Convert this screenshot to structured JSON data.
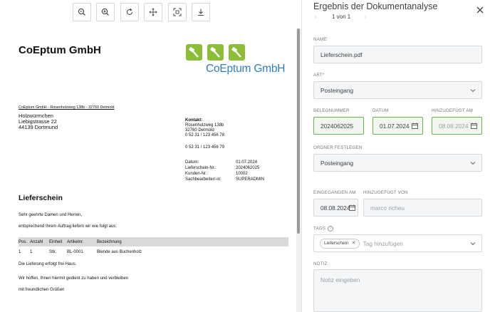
{
  "toolbar": {
    "buttons": [
      "zoom-out-icon",
      "zoom-in-icon",
      "rotate-icon",
      "move-icon",
      "fit-icon",
      "download-icon"
    ]
  },
  "document": {
    "company": "CoEptum GmbH",
    "logo_text": "CoEptum GmbH",
    "sender_line": "CoEptum GmbH - Rosenholzweg 138b - 32760 Detmold",
    "recipient": [
      "Holzwürmchen",
      "Liebigstrasse 22",
      "44139 Dortmund"
    ],
    "contact_title": "Kontakt:",
    "contact_lines": [
      "Rosenholzweg 138b",
      "32760 Detmold",
      "0 52 31 / 123 456 78"
    ],
    "contact_phone2": "0 52 31 / 123 456 79",
    "meta": [
      {
        "k": "Datum:",
        "v": "01.07.2024"
      },
      {
        "k": "Lieferschein-Nr.:",
        "v": "2024062025"
      },
      {
        "k": "Kunden-Nr.:",
        "v": "10002"
      },
      {
        "k": "Sachbearbeiter/-in:",
        "v": "SUPERADMIN"
      }
    ],
    "title": "Lieferschein",
    "greeting": "Sehr geehrte Damen und Herren,",
    "intro": "entsprechend Ihrem Auftrag liefern wir wie folgt aus:",
    "table_headers": [
      "Pos.",
      "Anzahl",
      "Einheit",
      "Artikelnr.",
      "Bezeichnung"
    ],
    "table_rows": [
      [
        "1",
        "1",
        "Stk.",
        "BL-0001",
        "Blende aus Buchenholz"
      ]
    ],
    "delivery_note": "Die Lieferung erfolgt frei Haus.",
    "closing": "Wir hoffen, Ihnen hiermit gedient zu haben und verbleiben",
    "regards": "mit freundlichen Grüßen"
  },
  "panel": {
    "title": "Ergebnis der Dokumentanalyse",
    "pager_prev": "‹",
    "pager_text": "1 von 1",
    "pager_next": "›",
    "name_label": "NAME",
    "name_value": "Lieferschein.pdf",
    "art_label": "ART*",
    "art_value": "Posteingang",
    "belegnummer_label": "BELEGNUMMER",
    "belegnummer_value": "2024062025",
    "datum_label": "DATUM",
    "datum_value": "01.07.2024",
    "hinzugefuegt_am_label": "HINZUGEFÜGT AM",
    "hinzugefuegt_am_value": "08.08.2024",
    "ordner_label": "ORDNER FESTLEGEN",
    "ordner_value": "Posteingang",
    "eingegangen_label": "EINGEGANGEN AM",
    "eingegangen_value": "08.08.2024",
    "hinzugefuegt_von_label": "HINZUGEFÜGT VON",
    "hinzugefuegt_von_value": "marco richeu",
    "tags_label": "TAGS",
    "tag_chip": "Lieferschein",
    "tag_placeholder": "Tag hinzufügen",
    "notiz_label": "NOTIZ",
    "notiz_placeholder": "Notiz eingeben"
  },
  "colors": {
    "accent_green": "#66b64a",
    "logo_green": "#8bbd36",
    "logo_blue": "#2f7fbd"
  }
}
